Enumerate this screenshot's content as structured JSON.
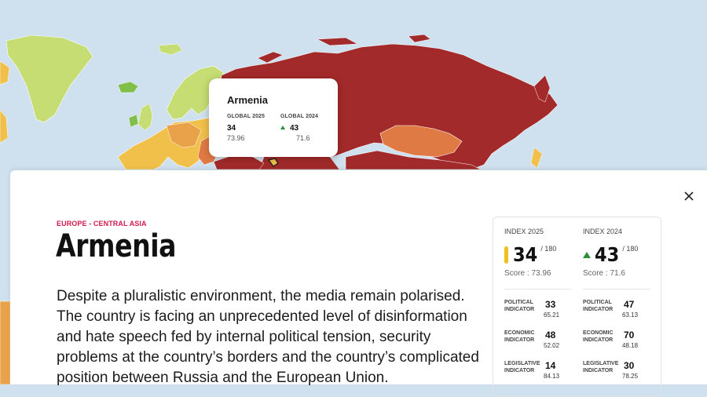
{
  "map": {
    "colors": {
      "ocean": "#cfe0ee",
      "very_serious": "#a32a2a",
      "difficult": "#e07a45",
      "problematic": "#f0c04a",
      "satisfactory": "#c5dd72",
      "good": "#7fbf4a"
    }
  },
  "tooltip": {
    "country": "Armenia",
    "col1": {
      "label": "GLOBAL 2025",
      "rank": "34",
      "score": "73.96"
    },
    "col2": {
      "label": "GLOBAL 2024",
      "rank": "43",
      "score": "71.6",
      "trend_icon": "arrow-up-icon"
    }
  },
  "panel": {
    "region": "EUROPE - CENTRAL ASIA",
    "country": "Armenia",
    "description": "Despite a pluralistic environment, the media remain polarised. The country is facing an unprecedented level of disinformation and hate speech fed by internal political tension, security problems at the country’s borders and the country’s complicated position between Russia and the European Union.",
    "close_icon": "close-icon"
  },
  "card": {
    "index_2025": {
      "label": "INDEX 2025",
      "rank": "34",
      "of": "/ 180",
      "score": "Score : 73.96",
      "rank_color": "#f0c020"
    },
    "index_2024": {
      "label": "INDEX 2024",
      "rank": "43",
      "of": "/ 180",
      "score": "Score : 71.6",
      "trend_icon": "arrow-up-icon",
      "trend_color": "#2a8f3a"
    },
    "indicators_2025": [
      {
        "name": "POLITICAL INDICATOR",
        "rank": "33",
        "score": "65.21"
      },
      {
        "name": "ECONOMIC INDICATOR",
        "rank": "48",
        "score": "52.02"
      },
      {
        "name": "LEGISLATIVE INDICATOR",
        "rank": "14",
        "score": "84.13"
      }
    ],
    "indicators_2024": [
      {
        "name": "POLITICAL INDICATOR",
        "rank": "47",
        "score": "63.13"
      },
      {
        "name": "ECONOMIC INDICATOR",
        "rank": "70",
        "score": "48.18"
      },
      {
        "name": "LEGISLATIVE INDICATOR",
        "rank": "30",
        "score": "78.25"
      }
    ]
  }
}
